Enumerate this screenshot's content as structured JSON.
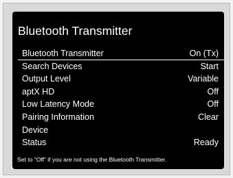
{
  "screen": {
    "title": "Bluetooth Transmitter",
    "help_text": "Set to “Off” if you are not using the Bluetooth Transmitter."
  },
  "menu": {
    "items": [
      {
        "label": "Bluetooth Transmitter",
        "value": "On (Tx)",
        "selected": true
      },
      {
        "label": "Search Devices",
        "value": "Start"
      },
      {
        "label": "Output Level",
        "value": "Variable"
      },
      {
        "label": "aptX HD",
        "value": "Off"
      },
      {
        "label": "Low Latency Mode",
        "value": "Off"
      },
      {
        "label": "Pairing Information",
        "value": "Clear"
      },
      {
        "label": "Device",
        "value": ""
      },
      {
        "label": "Status",
        "value": "Ready"
      }
    ]
  },
  "colors": {
    "panel_background": "#000000",
    "text": "#ffffff",
    "frame": "#d9d9d9"
  }
}
